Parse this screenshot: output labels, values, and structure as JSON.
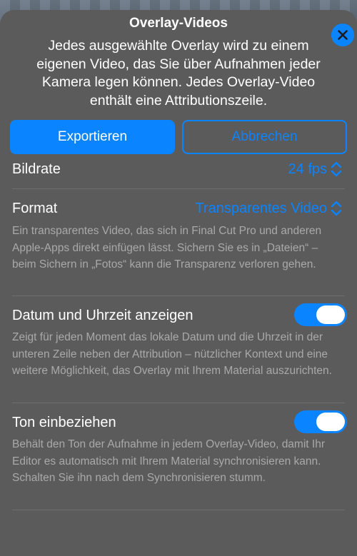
{
  "sheet": {
    "title": "Overlay-Videos",
    "description": "Jedes ausgewählte Overlay wird zu einem eigenen Video, das Sie über Aufnahmen jeder Kamera legen können. Jedes Overlay-Video enthält eine Attributionszeile."
  },
  "buttons": {
    "export": "Exportieren",
    "cancel": "Abbrechen"
  },
  "settings": {
    "framerate": {
      "label": "Bildrate",
      "value": "24 fps"
    },
    "format": {
      "label": "Format",
      "value": "Transparentes Video",
      "help": "Ein transparentes Video, das sich in Final Cut Pro und anderen Apple-Apps direkt einfügen lässt. Sichern Sie es in „Dateien“ – beim Sichern in „Fotos“ kann die Transparenz verloren gehen."
    },
    "datetime": {
      "label": "Datum und Uhrzeit anzeigen",
      "on": true,
      "help": "Zeigt für jeden Moment das lokale Datum und die Uhrzeit in der unteren Zeile neben der Attribution – nützlicher Kontext und eine weitere Möglichkeit, das Overlay mit Ihrem Material auszurichten."
    },
    "sound": {
      "label": "Ton einbeziehen",
      "on": true,
      "help": "Behält den Ton der Aufnahme in jedem Overlay-Video, damit Ihr Editor es automatisch mit Ihrem Material synchronisieren kann. Schalten Sie ihn nach dem Synchronisieren stumm."
    }
  },
  "colors": {
    "accent": "#0a84ff",
    "sheet": "#5b5b5b"
  },
  "icons": {
    "close": "close-icon",
    "chevron": "chevron-updown-icon"
  }
}
